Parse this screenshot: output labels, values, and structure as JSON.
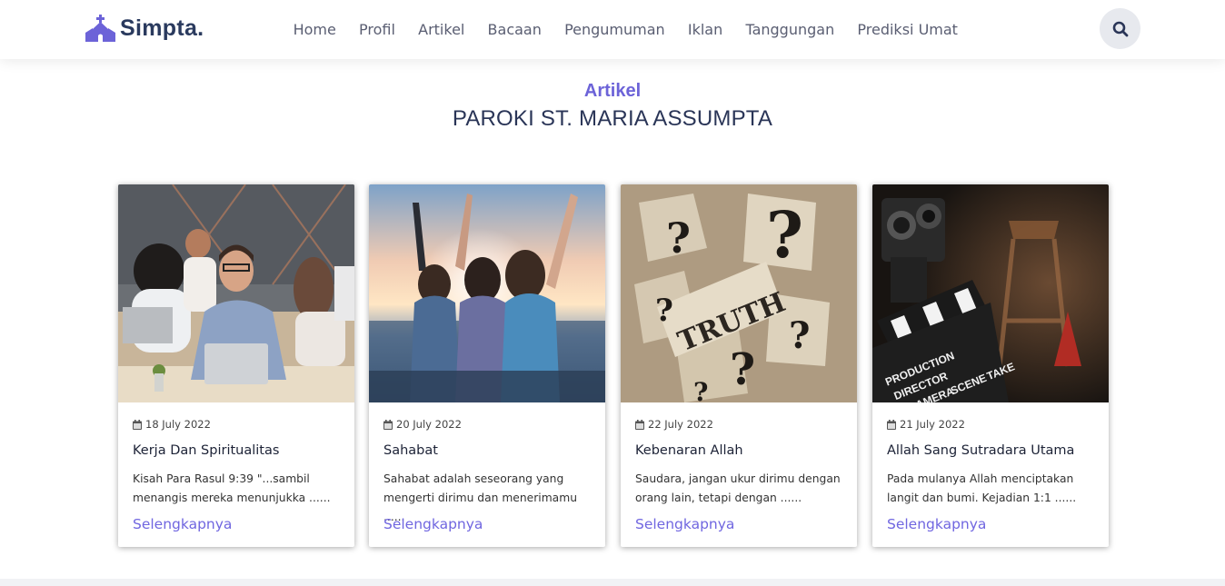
{
  "header": {
    "logo_text": "Simpta.",
    "nav": [
      "Home",
      "Profil",
      "Artikel",
      "Bacaan",
      "Pengumuman",
      "Iklan",
      "Tanggungan",
      "Prediksi Umat"
    ]
  },
  "section": {
    "kicker": "Artikel",
    "title": "PAROKI ST. MARIA ASSUMPTA"
  },
  "cards": [
    {
      "date": "18 July 2022",
      "title": "Kerja Dan Spiritualitas",
      "excerpt_line1": "Kisah Para Rasul 9:39 \"...sambil",
      "excerpt_line2": "menangis mereka menunjukka ......",
      "more": "Selengkapnya"
    },
    {
      "date": "20 July 2022",
      "title": "Sahabat",
      "excerpt_line1": "Sahabat adalah seseorang yang",
      "excerpt_line2": "mengerti dirimu dan menerimamu ......",
      "more": "Selengkapnya"
    },
    {
      "date": "22 July 2022",
      "title": "Kebenaran Allah",
      "excerpt_line1": "Saudara, jangan ukur dirimu dengan",
      "excerpt_line2": "orang lain, tetapi dengan ......",
      "more": "Selengkapnya",
      "image_text": "TRUTH"
    },
    {
      "date": "21 July 2022",
      "title": "Allah Sang Sutradara Utama",
      "excerpt_line1": "Pada mulanya Allah menciptakan",
      "excerpt_line2": "langit dan bumi. Kejadian 1:1 ......",
      "more": "Selengkapnya",
      "image_text": [
        "PRODUCTION",
        "DIRECTOR",
        "CAMERA",
        "SCENE",
        "TAKE"
      ]
    }
  ],
  "icons": {
    "logo": "church-icon",
    "search": "search-icon",
    "date": "calendar-icon"
  },
  "colors": {
    "accent": "#6c63d8",
    "link": "#7066e0",
    "heading": "#2a3557"
  }
}
